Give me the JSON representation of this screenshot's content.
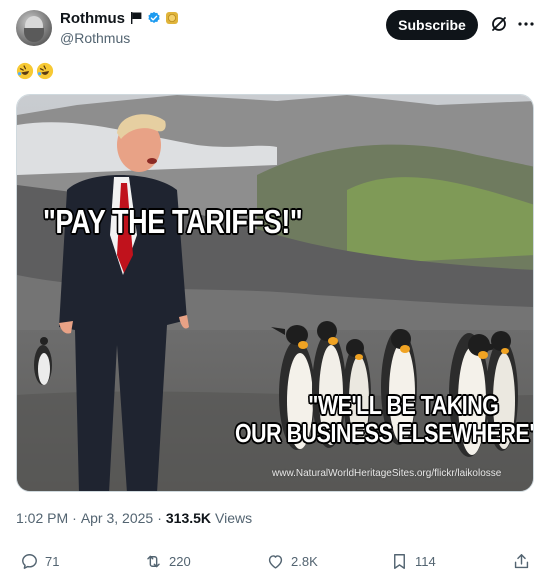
{
  "author": {
    "display_name": "Rothmus",
    "handle": "@Rothmus",
    "badges": [
      "flag-icon",
      "verified-icon",
      "gold-coin-icon"
    ]
  },
  "header": {
    "subscribe_label": "Subscribe",
    "icons": [
      "grok-icon",
      "more-icon"
    ]
  },
  "post": {
    "text_emojis": [
      "rolling-on-floor-laughing-emoji",
      "rolling-on-floor-laughing-emoji"
    ],
    "image": {
      "caption_top": "\"PAY THE TARIFFS!\"",
      "caption_bottom_line1": "\"WE'LL BE TAKING",
      "caption_bottom_line2": "OUR BUSINESS ELSEWHERE\"",
      "watermark": "www.NaturalWorldHeritageSites.org/flickr/laikolosse"
    }
  },
  "meta": {
    "time": "1:02 PM",
    "separator1": "·",
    "date": "Apr 3, 2025",
    "separator2": "·",
    "views_count": "313.5K",
    "views_label": "Views"
  },
  "actions": {
    "reply_count": "71",
    "repost_count": "220",
    "like_count": "2.8K",
    "bookmark_count": "114"
  },
  "colors": {
    "text_primary": "#0f1419",
    "text_secondary": "#536471",
    "verified_blue": "#1d9bf0",
    "button_dark": "#0f1419"
  }
}
